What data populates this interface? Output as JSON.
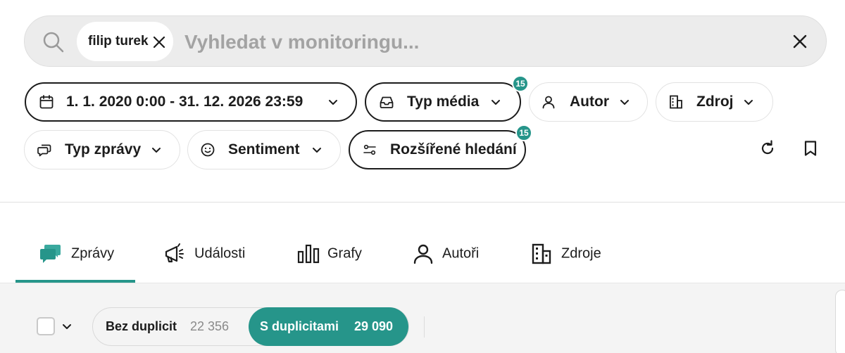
{
  "search": {
    "chip_label": "filip turek",
    "placeholder": "Vyhledat v monitoringu...",
    "value": ""
  },
  "filters": {
    "date": {
      "label": "1. 1. 2020 0:00 - 31. 12. 2026 23:59",
      "icon": "calendar-icon"
    },
    "media_type": {
      "label": "Typ média",
      "badge": "15",
      "icon": "inbox-icon"
    },
    "author": {
      "label": "Autor",
      "icon": "user-icon"
    },
    "source": {
      "label": "Zdroj",
      "icon": "building-icon"
    },
    "message_type": {
      "label": "Typ zprávy",
      "icon": "chat-icon"
    },
    "sentiment": {
      "label": "Sentiment",
      "icon": "smiley-icon"
    },
    "advanced": {
      "label": "Rozšířené hledání",
      "badge": "15",
      "icon": "sliders-icon"
    }
  },
  "tabs": [
    {
      "label": "Zprávy",
      "icon": "messages-icon",
      "active": true
    },
    {
      "label": "Události",
      "icon": "megaphone-icon",
      "active": false
    },
    {
      "label": "Grafy",
      "icon": "bar-chart-icon",
      "active": false
    },
    {
      "label": "Autoři",
      "icon": "user-icon",
      "active": false
    },
    {
      "label": "Zdroje",
      "icon": "building-icon",
      "active": false
    }
  ],
  "duplicates": {
    "without_label": "Bez duplicit",
    "without_count": "22 356",
    "with_label": "S duplicitami",
    "with_count": "29 090",
    "selected": "with"
  },
  "colors": {
    "accent": "#26958a",
    "text": "#1c1c1c",
    "placeholder": "#a3a3a3",
    "search_bg": "#ececec",
    "toolbar_bg": "#f4f4f4"
  }
}
